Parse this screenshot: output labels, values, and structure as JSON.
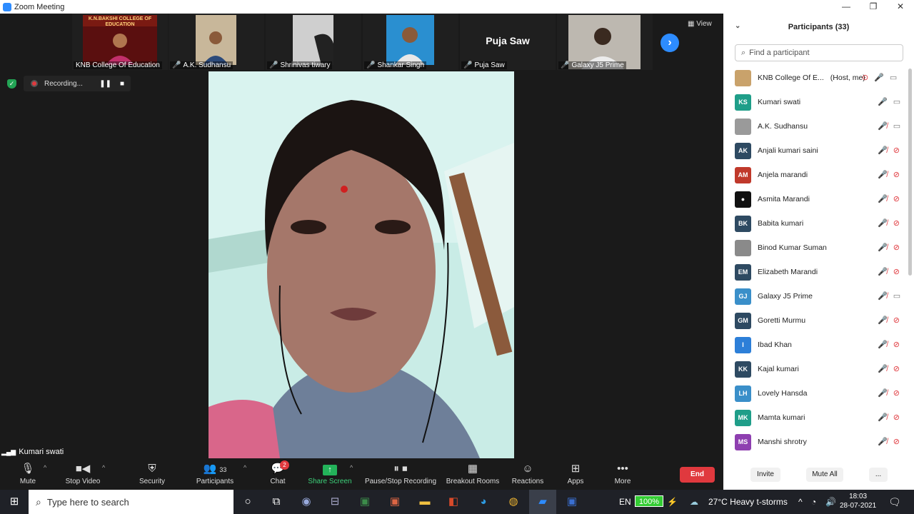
{
  "window": {
    "title": "Zoom Meeting",
    "controls": [
      "—",
      "❐",
      "✕"
    ]
  },
  "strip": {
    "tiles": [
      {
        "name": "KNB College Of Education",
        "sign": "K.N.BAKSHI COLLEGE OF EDUCATION",
        "muted": false
      },
      {
        "name": "A.K. Sudhansu",
        "muted": true
      },
      {
        "name": "Shrinivas tiwary",
        "muted": true
      },
      {
        "name": "Shankar Singh",
        "muted": true
      },
      {
        "name": "Puja Saw",
        "big_label": "Puja Saw",
        "muted": true
      },
      {
        "name": "Galaxy J5 Prime",
        "muted": true
      }
    ],
    "view_label": "View"
  },
  "recording": {
    "label": "Recording..."
  },
  "speaker": {
    "name": "Kumari swati"
  },
  "toolbar": {
    "mute": "Mute",
    "stop_video": "Stop Video",
    "security": "Security",
    "participants": "Participants",
    "participants_count": "33",
    "chat": "Chat",
    "chat_badge": "2",
    "share_screen": "Share Screen",
    "pause_stop_recording": "Pause/Stop Recording",
    "breakout_rooms": "Breakout Rooms",
    "reactions": "Reactions",
    "apps": "Apps",
    "more": "More",
    "end": "End"
  },
  "panel": {
    "title": "Participants (33)",
    "search_placeholder": "Find a participant",
    "participants": [
      {
        "name": "KNB College Of E...",
        "suffix": "(Host, me)",
        "initials": "",
        "color": "#c9a26b",
        "mic": "on",
        "video": "on"
      },
      {
        "name": "Kumari swati",
        "initials": "KS",
        "color": "#1f9e89",
        "mic": "on",
        "video": "on"
      },
      {
        "name": "A.K. Sudhansu",
        "initials": "",
        "color": "#9a9a9a",
        "mic": "off",
        "video": "on"
      },
      {
        "name": "Anjali kumari saini",
        "initials": "AK",
        "color": "#2e4a62",
        "mic": "off",
        "video": "off"
      },
      {
        "name": "Anjela marandi",
        "initials": "AM",
        "color": "#c0392b",
        "mic": "off",
        "video": "off"
      },
      {
        "name": "Asmita Marandi",
        "initials": "●",
        "color": "#111111",
        "mic": "off",
        "video": "off"
      },
      {
        "name": "Babita kumari",
        "initials": "BK",
        "color": "#2e4a62",
        "mic": "off",
        "video": "off"
      },
      {
        "name": "Binod Kumar Suman",
        "initials": "",
        "color": "#8a8a8a",
        "mic": "off",
        "video": "off"
      },
      {
        "name": "Elizabeth Marandi",
        "initials": "EM",
        "color": "#2e4a62",
        "mic": "off",
        "video": "off"
      },
      {
        "name": "Galaxy J5 Prime",
        "initials": "GJ",
        "color": "#3a8fc9",
        "mic": "off",
        "video": "on"
      },
      {
        "name": "Goretti Murmu",
        "initials": "GM",
        "color": "#2e4a62",
        "mic": "off",
        "video": "off"
      },
      {
        "name": "Ibad Khan",
        "initials": "I",
        "color": "#2d7fd8",
        "mic": "off",
        "video": "off"
      },
      {
        "name": "Kajal kumari",
        "initials": "KK",
        "color": "#2e4a62",
        "mic": "off",
        "video": "off"
      },
      {
        "name": "Lovely Hansda",
        "initials": "LH",
        "color": "#3a8fc9",
        "mic": "off",
        "video": "off"
      },
      {
        "name": "Mamta kumari",
        "initials": "MK",
        "color": "#1f9e89",
        "mic": "off",
        "video": "off"
      },
      {
        "name": "Manshi shrotry",
        "initials": "MS",
        "color": "#8e3fb0",
        "mic": "off",
        "video": "off"
      }
    ],
    "invite": "Invite",
    "mute_all": "Mute All",
    "more": "..."
  },
  "taskbar": {
    "search_placeholder": "Type here to search",
    "lang": "EN",
    "battery": "100%",
    "weather": "27°C  Heavy t-storms",
    "time": "18:03",
    "date": "28-07-2021"
  }
}
